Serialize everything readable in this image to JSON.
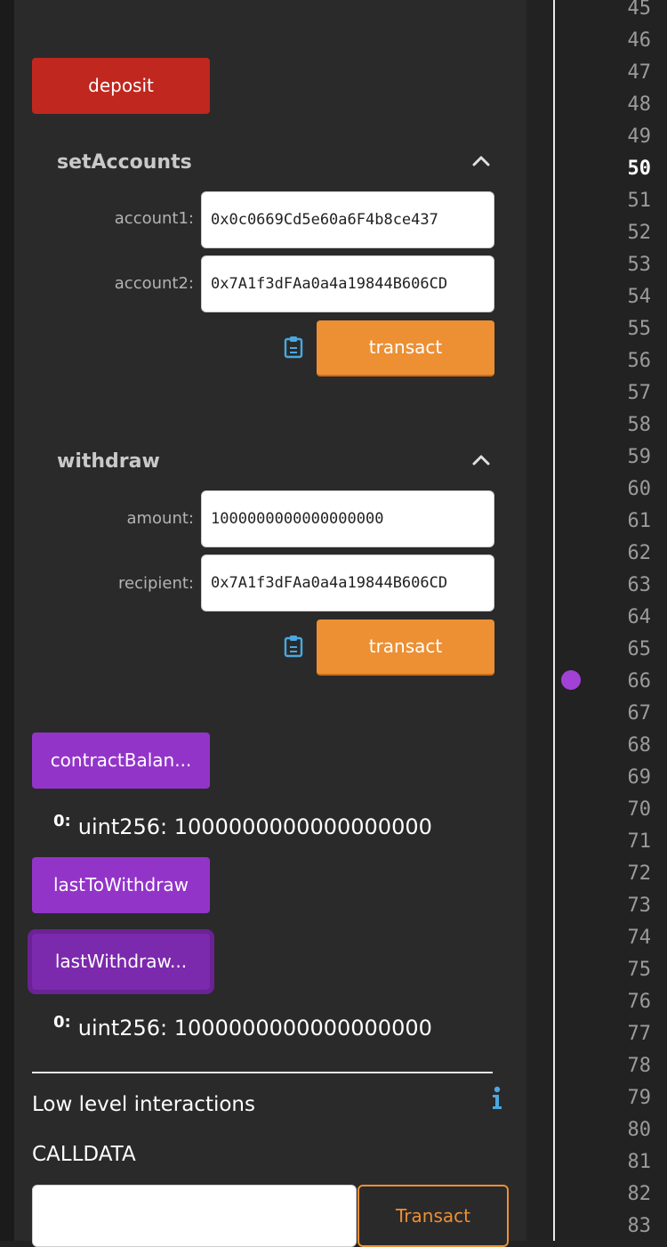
{
  "buttons": {
    "deposit": "deposit",
    "transact": "transact",
    "contract_balance": "contractBalan...",
    "last_to_withdraw": "lastToWithdraw",
    "last_withdraw": "lastWithdraw...",
    "calldata_transact": "Transact"
  },
  "set_accounts": {
    "title": "setAccounts",
    "account1_label": "account1:",
    "account1_value": "0x0c0669Cd5e60a6F4b8ce437",
    "account2_label": "account2:",
    "account2_value": "0x7A1f3dFAa0a4a19844B606CD"
  },
  "withdraw": {
    "title": "withdraw",
    "amount_label": "amount:",
    "amount_value": "1000000000000000000",
    "recipient_label": "recipient:",
    "recipient_value": "0x7A1f3dFAa0a4a19844B606CD"
  },
  "results": {
    "contract_balance": {
      "index": "0:",
      "value": "uint256: 1000000000000000000"
    },
    "last_withdraw": {
      "index": "0:",
      "value": "uint256: 1000000000000000000"
    }
  },
  "low_level": {
    "title": "Low level interactions",
    "calldata_label": "CALLDATA"
  },
  "editor": {
    "line_numbers": [
      "45",
      "46",
      "47",
      "48",
      "49",
      "50",
      "51",
      "52",
      "53",
      "54",
      "55",
      "56",
      "57",
      "58",
      "59",
      "60",
      "61",
      "62",
      "63",
      "64",
      "65",
      "66",
      "67",
      "68",
      "69",
      "70",
      "71",
      "72",
      "73",
      "74",
      "75",
      "76",
      "77",
      "78",
      "79",
      "80",
      "81",
      "82",
      "83"
    ],
    "active_line": "50",
    "breakpoint_line": "66"
  },
  "colors": {
    "deposit": "#c0271e",
    "transact": "#ed8f33",
    "call": "#9334c9",
    "breakpoint": "#a241d6",
    "info": "#4aa8e0"
  },
  "icons": [
    "chevron-up-icon",
    "clipboard-icon",
    "info-icon"
  ]
}
